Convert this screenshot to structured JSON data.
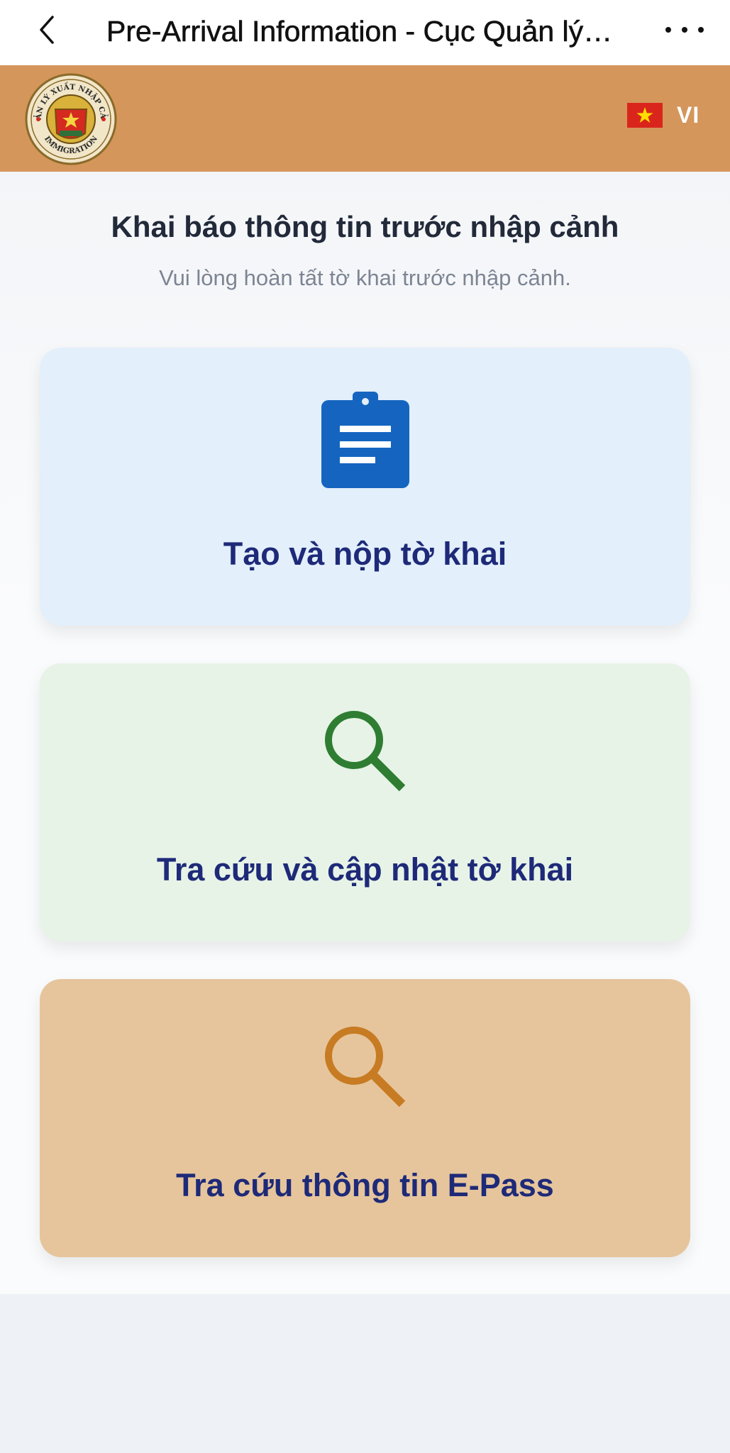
{
  "navbar": {
    "title": "Pre-Arrival Information - Cục Quản lý Xuất nhập cảnh"
  },
  "header": {
    "logo_text": "QUẢN LÝ XUẤT NHẬP CẢNH · IMMIGRATION",
    "language_code": "VI",
    "brand_color": "#d4965a"
  },
  "main": {
    "title": "Khai báo thông tin trước nhập cảnh",
    "subtitle": "Vui lòng hoàn tất tờ khai trước nhập cảnh."
  },
  "cards": [
    {
      "label": "Tạo và nộp tờ khai",
      "icon": "clipboard-icon",
      "background": "#e3effb",
      "icon_color": "#1565c0"
    },
    {
      "label": "Tra cứu và cập nhật tờ khai",
      "icon": "search-icon",
      "background": "#e7f3e7",
      "icon_color": "#2e7d32"
    },
    {
      "label": "Tra cứu thông tin E-Pass",
      "icon": "search-icon",
      "background": "#e6c59c",
      "icon_color": "#c77b22"
    }
  ],
  "colors": {
    "card_label": "#1e2a78",
    "title": "#222a3a",
    "subtitle": "#7d8593"
  }
}
